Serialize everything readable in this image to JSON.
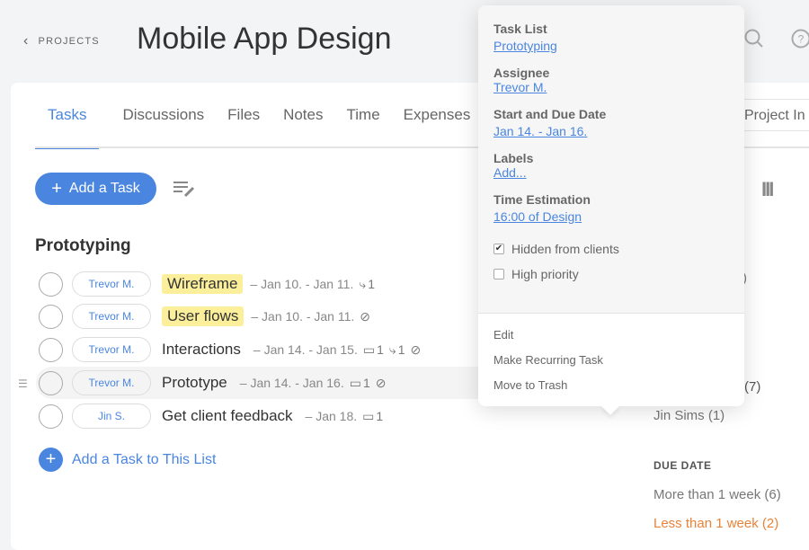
{
  "header": {
    "back_label": "PROJECTS",
    "title": "Mobile App Design"
  },
  "tabs": [
    {
      "label": "Tasks",
      "active": true
    },
    {
      "label": "Discussions"
    },
    {
      "label": "Files"
    },
    {
      "label": "Notes"
    },
    {
      "label": "Time"
    },
    {
      "label": "Expenses"
    },
    {
      "label": "Project In"
    }
  ],
  "toolbar": {
    "add_task": "Add a Task"
  },
  "list": {
    "title": "Prototyping",
    "add_label": "Add a Task to This List",
    "tasks": [
      {
        "assignee": "Trevor M.",
        "name": "Wireframe",
        "dates": "– Jan 10. - Jan 11.",
        "subtasks": "1",
        "labeled": true
      },
      {
        "assignee": "Trevor M.",
        "name": "User flows",
        "dates": "– Jan 10. - Jan 11.",
        "hidden": true,
        "labeled": true
      },
      {
        "assignee": "Trevor M.",
        "name": "Interactions",
        "dates": "– Jan 14. - Jan 15.",
        "comments": "1",
        "subtasks": "1",
        "hidden": true
      },
      {
        "assignee": "Trevor M.",
        "name": "Prototype",
        "dates": "– Jan 14. - Jan 16.",
        "comments": "1",
        "hidden": true
      },
      {
        "assignee": "Jin S.",
        "name": "Get client feedback",
        "dates": "– Jan 18.",
        "comments": "1"
      }
    ]
  },
  "sidebar": {
    "partial1": ")",
    "partial2": "(7)",
    "assignee_jin": "Jin Sims (1)",
    "due_heading": "DUE DATE",
    "due_more": "More than 1 week (6)",
    "due_less": "Less than 1 week (2)",
    "due_less_color": "#e8833a"
  },
  "popover": {
    "task_list_label": "Task List",
    "task_list": "Prototyping",
    "assignee_label": "Assignee",
    "assignee": "Trevor M.",
    "dates_label": "Start and Due Date",
    "dates": "Jan 14. - Jan 16.",
    "labels_label": "Labels",
    "labels_add": "Add...",
    "estimation_label": "Time Estimation",
    "estimation": "16:00 of Design",
    "hidden_clients": "Hidden from clients",
    "hidden_checked": true,
    "high_priority": "High priority",
    "high_checked": false,
    "menu": [
      "Edit",
      "Make Recurring Task",
      "Move to Trash"
    ]
  },
  "accent": "#4a86e0"
}
